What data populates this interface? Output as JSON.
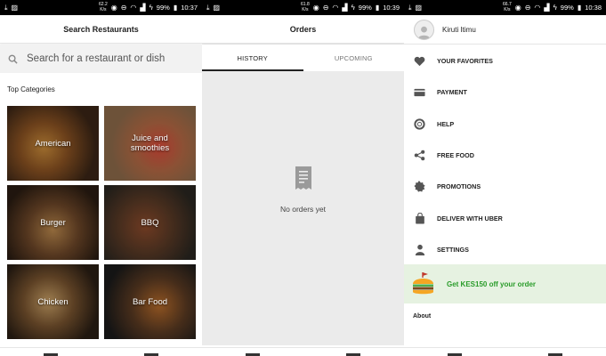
{
  "status_bars": [
    {
      "speed": "62.2\nK/s",
      "battery": "99%",
      "time": "10:37"
    },
    {
      "speed": "61.8\nK/s",
      "battery": "99%",
      "time": "10:39"
    },
    {
      "speed": "66.7\nK/s",
      "battery": "99%",
      "time": "10:38"
    }
  ],
  "search_screen": {
    "title": "Search Restaurants",
    "search_placeholder": "Search for a restaurant or dish",
    "section_title": "Top Categories",
    "categories": [
      {
        "label": "American"
      },
      {
        "label": "Juice and smoothies"
      },
      {
        "label": "Burger"
      },
      {
        "label": "BBQ"
      },
      {
        "label": "Chicken"
      },
      {
        "label": "Bar Food"
      }
    ]
  },
  "orders_screen": {
    "title": "Orders",
    "tabs": [
      {
        "label": "HISTORY",
        "active": true
      },
      {
        "label": "UPCOMING",
        "active": false
      }
    ],
    "empty_text": "No orders yet"
  },
  "menu_screen": {
    "user_name": "Kiruti Itimu",
    "items": [
      {
        "label": "YOUR FAVORITES",
        "icon": "heart-icon"
      },
      {
        "label": "PAYMENT",
        "icon": "card-icon"
      },
      {
        "label": "HELP",
        "icon": "lifebuoy-icon"
      },
      {
        "label": "FREE FOOD",
        "icon": "share-icon"
      },
      {
        "label": "PROMOTIONS",
        "icon": "badge-icon"
      },
      {
        "label": "DELIVER WITH UBER",
        "icon": "bag-icon"
      },
      {
        "label": "SETTINGS",
        "icon": "person-icon"
      }
    ],
    "promo_text": "Get KES150 off your order",
    "about_label": "About"
  },
  "colors": {
    "promo_bg": "#e6f2e1",
    "promo_text": "#2a9c2a",
    "orders_bg": "#ebebeb"
  }
}
